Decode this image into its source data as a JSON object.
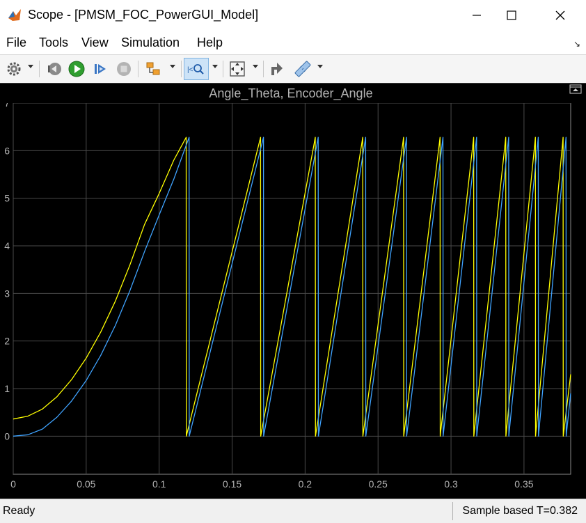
{
  "window": {
    "title": "Scope - [PMSM_FOC_PowerGUI_Model]"
  },
  "menu": {
    "items": [
      "File",
      "Tools",
      "View",
      "Simulation",
      "Help"
    ]
  },
  "toolbar": {
    "icons": [
      "gear-icon",
      "step-back-icon",
      "run-icon",
      "step-forward-icon",
      "stop-icon",
      "highlight-block-icon",
      "zoom-icon",
      "autoscale-icon",
      "write-data-icon",
      "measure-icon"
    ]
  },
  "plot": {
    "title": "Angle_Theta, Encoder_Angle",
    "background": "#000000",
    "grid_color": "#4a4a4a",
    "tick_label_color": "#b4b4b4"
  },
  "chart_data": {
    "type": "line",
    "title": "Angle_Theta, Encoder_Angle",
    "xlim": [
      0,
      0.382
    ],
    "ylim": [
      -0.8,
      7.0
    ],
    "xticks": [
      "0",
      "0.05",
      "0.1",
      "0.15",
      "0.2",
      "0.25",
      "0.3",
      "0.35"
    ],
    "yticks": [
      "0",
      "1",
      "2",
      "3",
      "4",
      "5",
      "6",
      "7"
    ],
    "grid": true,
    "series": [
      {
        "color": "#ffff00",
        "x": [
          0,
          0.01,
          0.02,
          0.03,
          0.04,
          0.05,
          0.06,
          0.07,
          0.08,
          0.09,
          0.1,
          0.11,
          0.1185,
          0.1186,
          0.1695,
          0.1696,
          0.207,
          0.2071,
          0.2395,
          0.2396,
          0.2675,
          0.2676,
          0.2925,
          0.2926,
          0.3155,
          0.3156,
          0.3375,
          0.3376,
          0.3578,
          0.3579,
          0.3768,
          0.3769,
          0.382
        ],
        "y": [
          0.36,
          0.42,
          0.57,
          0.83,
          1.19,
          1.64,
          2.19,
          2.84,
          3.6,
          4.45,
          5.1,
          5.8,
          6.28,
          0,
          6.28,
          0,
          6.28,
          0,
          6.28,
          0,
          6.28,
          0,
          6.28,
          0,
          6.28,
          0,
          6.28,
          0,
          6.28,
          0,
          6.28,
          0,
          1.3
        ]
      },
      {
        "color": "#3fa3ff",
        "x": [
          0,
          0.01,
          0.02,
          0.03,
          0.04,
          0.05,
          0.06,
          0.07,
          0.08,
          0.09,
          0.1,
          0.11,
          0.1205,
          0.1206,
          0.1715,
          0.1716,
          0.209,
          0.2091,
          0.2415,
          0.2416,
          0.2695,
          0.2696,
          0.2945,
          0.2946,
          0.3175,
          0.3176,
          0.3395,
          0.3396,
          0.3598,
          0.3599,
          0.3788,
          0.3789,
          0.382
        ],
        "y": [
          0,
          0.03,
          0.15,
          0.4,
          0.74,
          1.17,
          1.7,
          2.33,
          3.06,
          3.88,
          4.65,
          5.4,
          6.28,
          0,
          6.28,
          0,
          6.28,
          0,
          6.28,
          0,
          6.28,
          0,
          6.28,
          0,
          6.28,
          0,
          6.28,
          0,
          6.28,
          0,
          6.28,
          0,
          0.9
        ]
      }
    ]
  },
  "status": {
    "left": "Ready",
    "right": "Sample based  T=0.382"
  }
}
